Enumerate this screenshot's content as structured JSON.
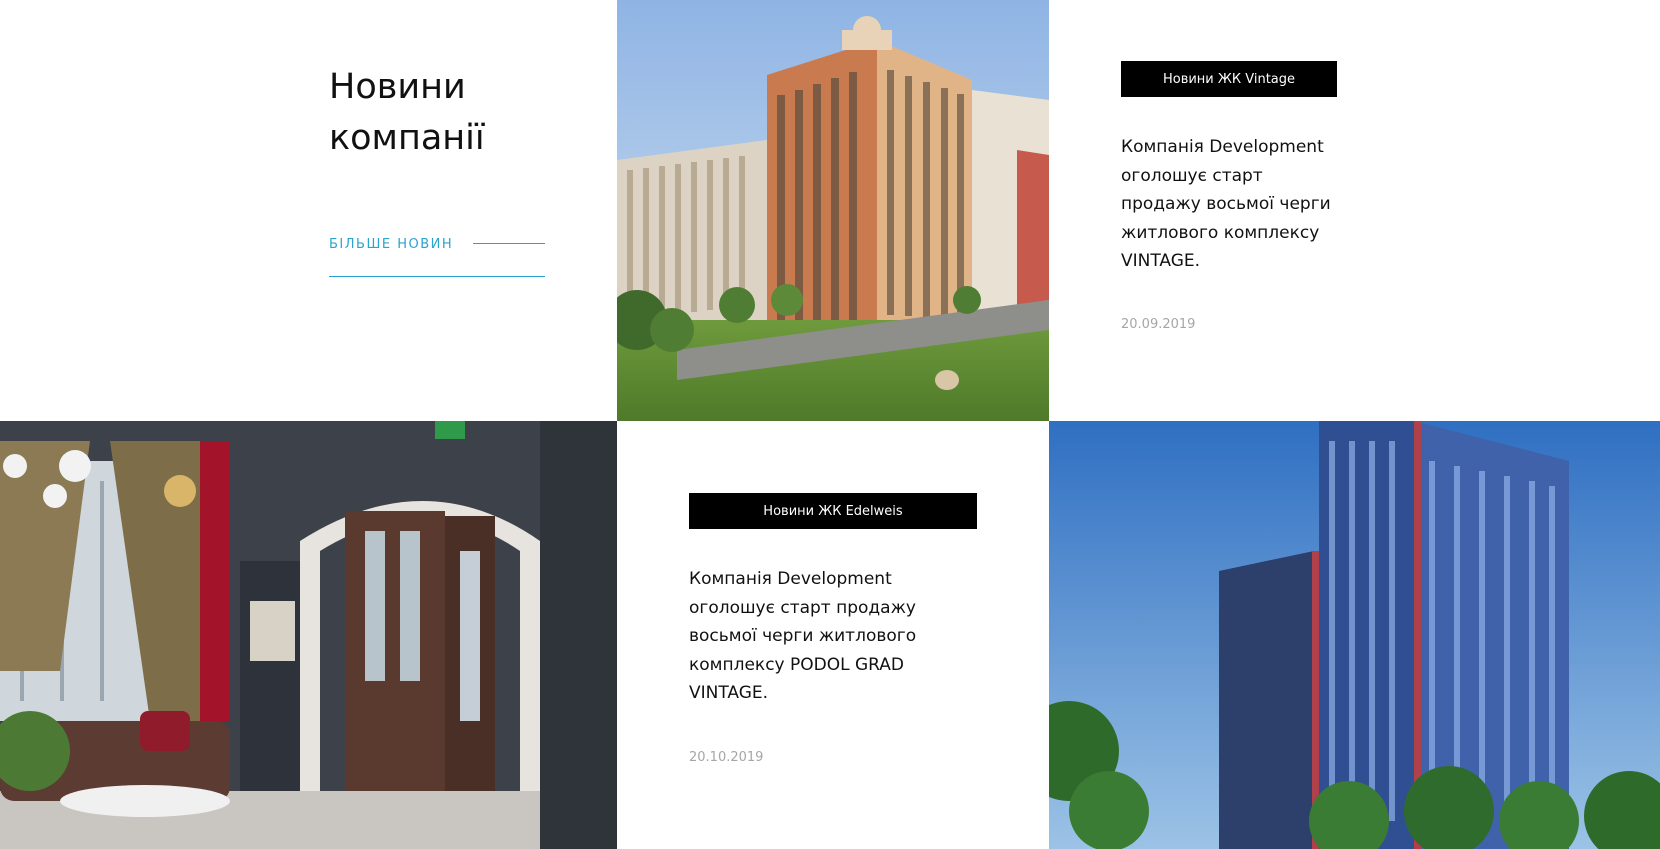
{
  "intro": {
    "title_line1": "Новини",
    "title_line2": "компанії",
    "more_news_label": "БІЛЬШЕ НОВИН"
  },
  "news": [
    {
      "tag": "Новини ЖК Vintage",
      "headline_lines": [
        "Компанія Development",
        "оголошує старт",
        "продажу восьмої черги",
        "житлового комплексу",
        "VINTAGE."
      ],
      "date": "20.09.2019"
    },
    {
      "tag": "Новини ЖК Edelweis",
      "headline_lines": [
        "Компанія Development",
        "оголошує старт продажу",
        "восьмої черги житлового",
        "комплексу PODOL GRAD",
        "VINTAGE."
      ],
      "date": "20.10.2019"
    }
  ],
  "images": {
    "building_photo": "residential-building-photo",
    "interior_photo": "lobby-interior-photo",
    "towers_photo": "high-rise-towers-photo"
  },
  "colors": {
    "accent": "#2aa3d1",
    "badge_bg": "#000000",
    "date": "#a6a6a6"
  }
}
